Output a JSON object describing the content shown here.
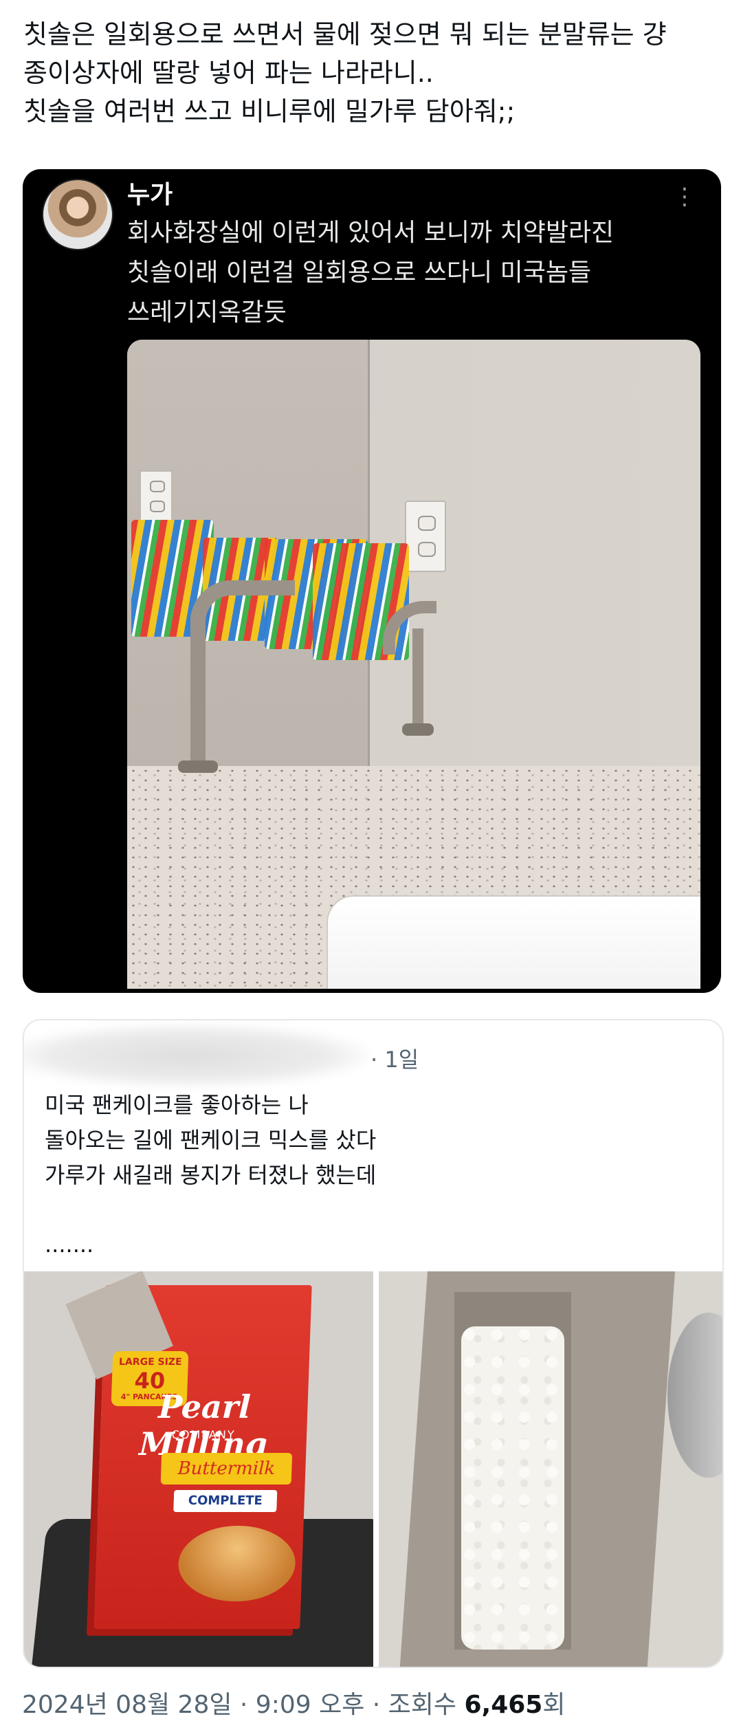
{
  "main_text": [
    "칫솔은 일회용으로 쓰면서 물에 젖으면 뭐 되는 분말류는 걍",
    "종이상자에 딸랑 넣어 파는 나라라니..",
    "칫솔을 여러번 쓰고 비니루에 밀가루 담아줘;;"
  ],
  "quoted_post": {
    "author": "누가",
    "more_icon": "more-icon",
    "more_glyph": "⋮",
    "body": [
      "회사화장실에 이런게 있어서 보니까 치약발라진",
      "칫솔이래 이런걸 일회용으로 쓰다니 미국놈들",
      "쓰레기지옥갈듯"
    ]
  },
  "second_post": {
    "time": "· 1일",
    "body": [
      "미국 팬케이크를 좋아하는 나",
      "돌아오는 길에 팬케이크 믹스를 샀다",
      "가루가 새길래 봉지가 터졌나 했는데"
    ],
    "ellipsis": ".......",
    "box": {
      "brand": "Pearl Milling",
      "company": "COMPANY",
      "flavor": "Buttermilk",
      "complete": "COMPLETE",
      "size_line1": "LARGE SIZE",
      "size_line2": "40",
      "size_line3": "4\" PANCAKES"
    }
  },
  "meta": {
    "date": "2024년 08월 28일 · 9:09 오후 · 조회수 ",
    "views": "6,465",
    "views_suffix": "회"
  }
}
